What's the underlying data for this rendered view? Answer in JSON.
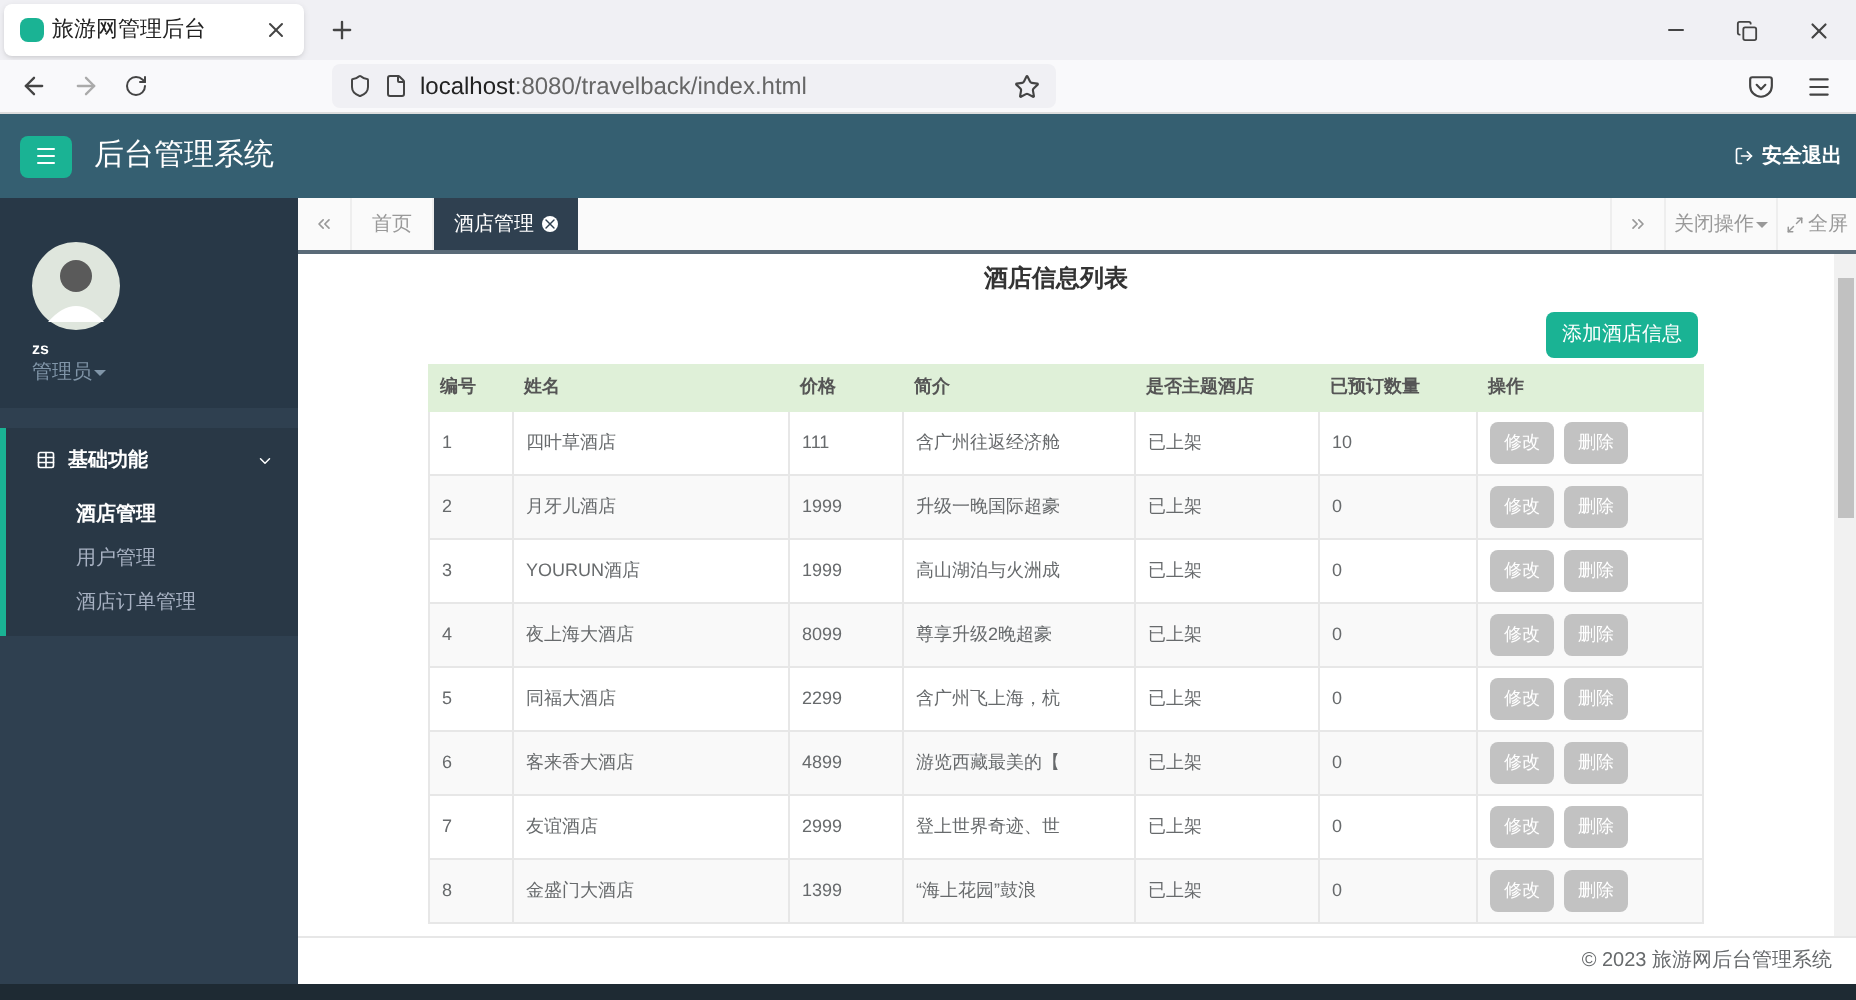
{
  "browser": {
    "tab_title": "旅游网管理后台",
    "url_host": "localhost",
    "url_path": ":8080/travelback/index.html"
  },
  "header": {
    "title": "后台管理系统",
    "logout": "安全退出"
  },
  "user": {
    "name": "zs",
    "role": "管理员"
  },
  "sidebar": {
    "group": {
      "label": "基础功能",
      "expanded": true,
      "children": [
        {
          "label": "酒店管理",
          "selected": true
        },
        {
          "label": "用户管理",
          "selected": false
        },
        {
          "label": "酒店订单管理",
          "selected": false
        }
      ]
    }
  },
  "tabs": [
    {
      "label": "首页",
      "selected": false,
      "closable": false
    },
    {
      "label": "酒店管理",
      "selected": true,
      "closable": true
    }
  ],
  "tab_actions": {
    "close_ops": "关闭操作",
    "fullscreen": "全屏"
  },
  "page": {
    "title": "酒店信息列表",
    "add_button": "添加酒店信息"
  },
  "table": {
    "columns": [
      "编号",
      "姓名",
      "价格",
      "简介",
      "是否主题酒店",
      "已预订数量",
      "操作"
    ],
    "rows": [
      {
        "cells": [
          "1",
          "四叶草酒店",
          "111",
          "含广州往返经济舱",
          "已上架",
          "10"
        ],
        "actions": [
          "修改",
          "删除"
        ]
      },
      {
        "cells": [
          "2",
          "月牙儿酒店",
          "1999",
          "升级一晚国际超豪",
          "已上架",
          "0"
        ],
        "actions": [
          "修改",
          "删除"
        ]
      },
      {
        "cells": [
          "3",
          "YOURUN酒店",
          "1999",
          "高山湖泊与火洲成",
          "已上架",
          "0"
        ],
        "actions": [
          "修改",
          "删除"
        ]
      },
      {
        "cells": [
          "4",
          "夜上海大酒店",
          "8099",
          "尊享升级2晚超豪",
          "已上架",
          "0"
        ],
        "actions": [
          "修改",
          "删除"
        ]
      },
      {
        "cells": [
          "5",
          "同福大酒店",
          "2299",
          "含广州飞上海，杭",
          "已上架",
          "0"
        ],
        "actions": [
          "修改",
          "删除"
        ]
      },
      {
        "cells": [
          "6",
          "客来香大酒店",
          "4899",
          "游览西藏最美的【",
          "已上架",
          "0"
        ],
        "actions": [
          "修改",
          "删除"
        ]
      },
      {
        "cells": [
          "7",
          "友谊酒店",
          "2999",
          "登上世界奇迹、世",
          "已上架",
          "0"
        ],
        "actions": [
          "修改",
          "删除"
        ]
      },
      {
        "cells": [
          "8",
          "金盛门大酒店",
          "1399",
          "“海上花园”鼓浪",
          "已上架",
          "0"
        ],
        "actions": [
          "修改",
          "删除"
        ]
      }
    ]
  },
  "footer": "© 2023 旅游网后台管理系统"
}
